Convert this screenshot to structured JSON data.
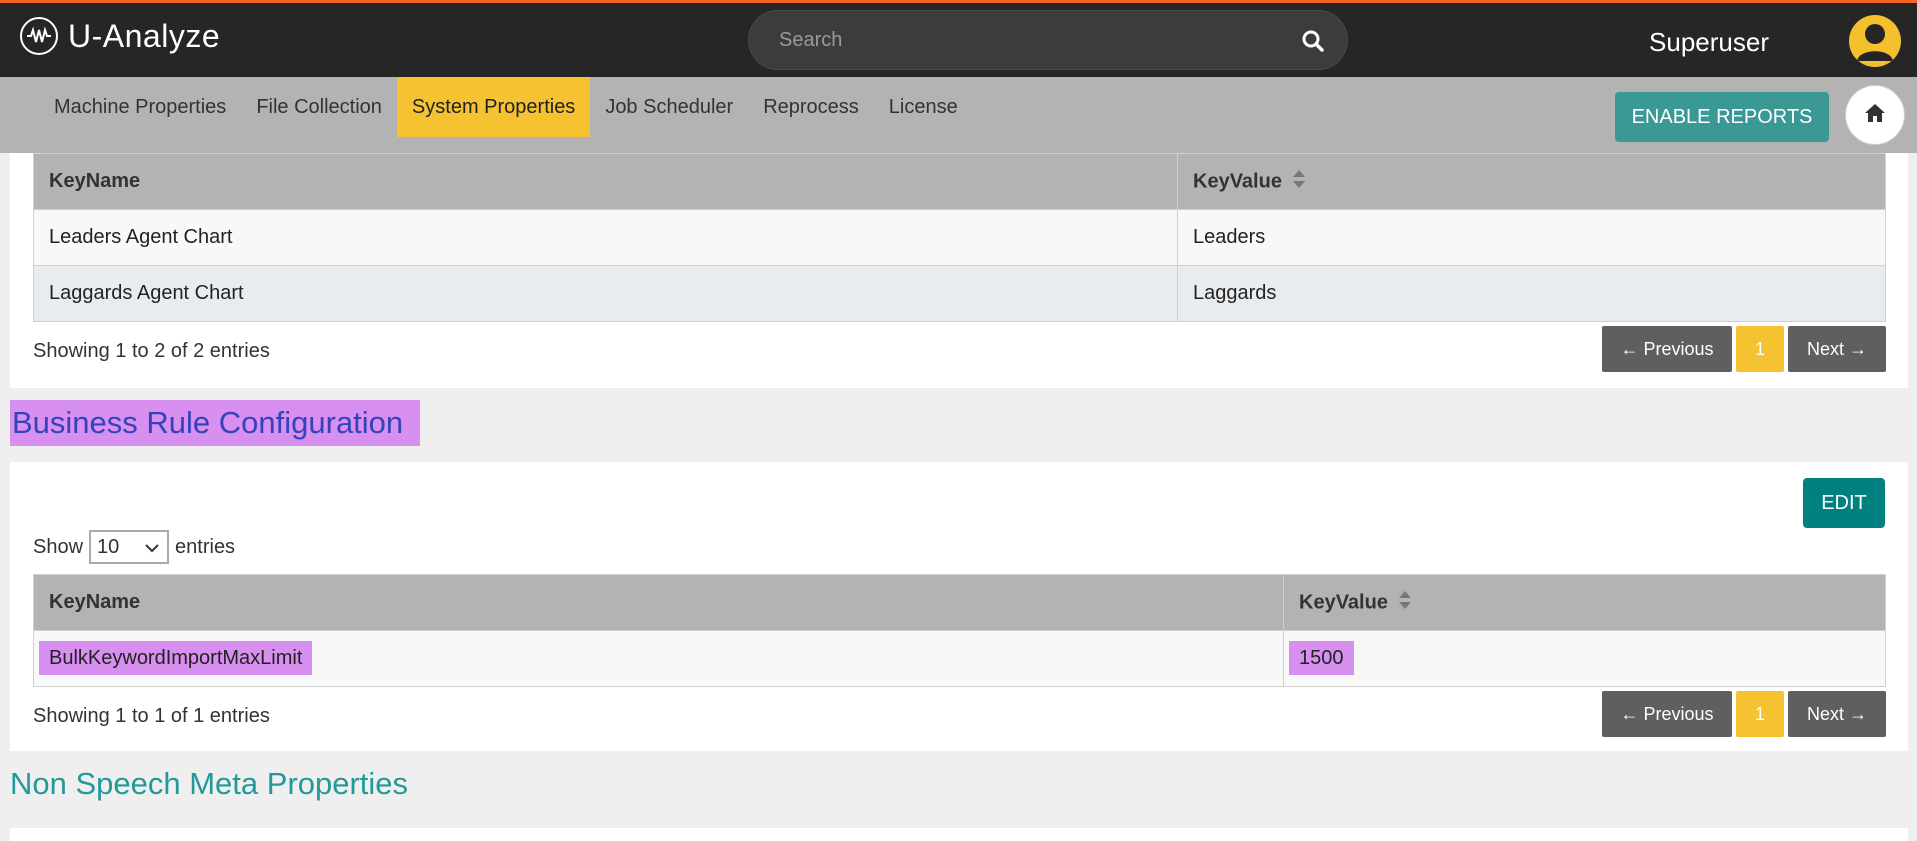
{
  "header": {
    "app_name": "U-Analyze",
    "search_placeholder": "Search",
    "user_name": "Superuser"
  },
  "nav": {
    "tabs": [
      {
        "label": "Machine Properties"
      },
      {
        "label": "File Collection"
      },
      {
        "label": "System Properties"
      },
      {
        "label": "Job Scheduler"
      },
      {
        "label": "Reprocess"
      },
      {
        "label": "License"
      }
    ],
    "active_tab": "System Properties",
    "enable_reports_label": "ENABLE REPORTS"
  },
  "table1": {
    "columns": [
      "KeyName",
      "KeyValue"
    ],
    "rows": [
      [
        "Leaders Agent Chart",
        "Leaders"
      ],
      [
        "Laggards Agent Chart",
        "Laggards"
      ]
    ],
    "info": "Showing 1 to 2 of 2 entries",
    "pagination": {
      "prev": "← Previous",
      "current": "1",
      "next": "Next →"
    }
  },
  "business_rule": {
    "title": "Business Rule Configuration",
    "edit_label": "EDIT",
    "show_label": "Show",
    "entries_label": "entries",
    "page_size": "10",
    "columns": [
      "KeyName",
      "KeyValue"
    ],
    "rows": [
      [
        "BulkKeywordImportMaxLimit",
        "1500"
      ]
    ],
    "info": "Showing 1 to 1 of 1 entries",
    "pagination": {
      "prev": "← Previous",
      "current": "1",
      "next": "Next →"
    }
  },
  "non_speech": {
    "title": "Non Speech Meta Properties"
  },
  "colors": {
    "accent_orange": "#f26522",
    "active_tab": "#f5c232",
    "teal_button": "#3a9895",
    "highlight": "#d78ff0"
  }
}
